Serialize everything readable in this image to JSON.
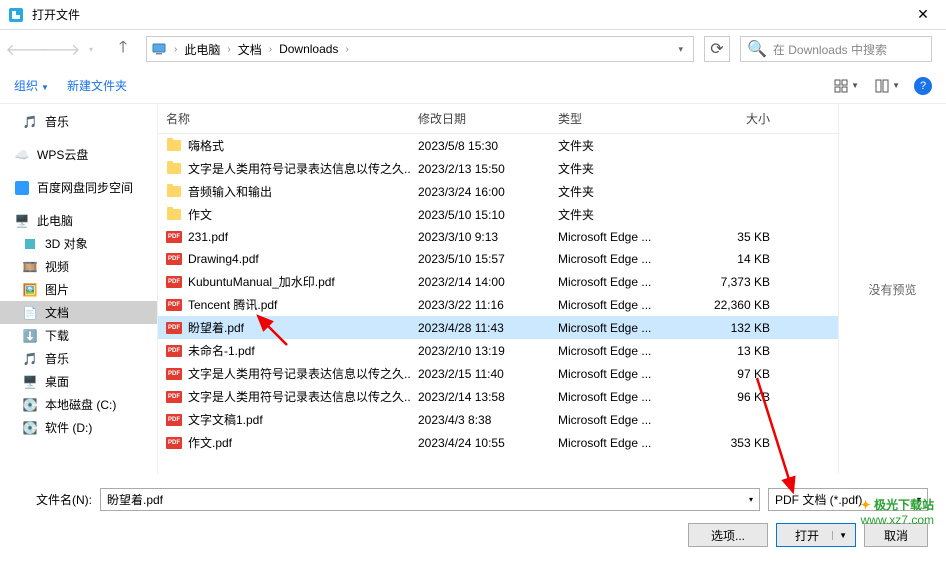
{
  "title": "打开文件",
  "breadcrumb": {
    "pc": "此电脑",
    "docs": "文档",
    "downloads": "Downloads"
  },
  "search_placeholder": "在 Downloads 中搜索",
  "toolbar": {
    "organize": "组织",
    "newfolder": "新建文件夹"
  },
  "sidebar": {
    "music": "音乐",
    "wps": "WPS云盘",
    "baidu": "百度网盘同步空间",
    "thispc": "此电脑",
    "obj3d": "3D 对象",
    "video": "视频",
    "pictures": "图片",
    "documents": "文档",
    "downloads_s": "下载",
    "music2": "音乐",
    "desktop": "桌面",
    "diskc": "本地磁盘 (C:)",
    "diskd": "软件 (D:)"
  },
  "columns": {
    "name": "名称",
    "date": "修改日期",
    "type": "类型",
    "size": "大小"
  },
  "rows": [
    {
      "icon": "folder",
      "name": "嗨格式",
      "date": "2023/5/8 15:30",
      "type": "文件夹",
      "size": ""
    },
    {
      "icon": "folder",
      "name": "文字是人类用符号记录表达信息以传之久...",
      "date": "2023/2/13 15:50",
      "type": "文件夹",
      "size": ""
    },
    {
      "icon": "folder",
      "name": "音频输入和输出",
      "date": "2023/3/24 16:00",
      "type": "文件夹",
      "size": ""
    },
    {
      "icon": "folder",
      "name": "作文",
      "date": "2023/5/10 15:10",
      "type": "文件夹",
      "size": ""
    },
    {
      "icon": "pdf",
      "name": "231.pdf",
      "date": "2023/3/10 9:13",
      "type": "Microsoft Edge ...",
      "size": "35 KB"
    },
    {
      "icon": "pdf",
      "name": "Drawing4.pdf",
      "date": "2023/5/10 15:57",
      "type": "Microsoft Edge ...",
      "size": "14 KB"
    },
    {
      "icon": "pdf",
      "name": "KubuntuManual_加水印.pdf",
      "date": "2023/2/14 14:00",
      "type": "Microsoft Edge ...",
      "size": "7,373 KB"
    },
    {
      "icon": "pdf",
      "name": "Tencent 腾讯.pdf",
      "date": "2023/3/22 11:16",
      "type": "Microsoft Edge ...",
      "size": "22,360 KB"
    },
    {
      "icon": "pdf",
      "name": "盼望着.pdf",
      "date": "2023/4/28 11:43",
      "type": "Microsoft Edge ...",
      "size": "132 KB",
      "selected": true
    },
    {
      "icon": "pdf",
      "name": "未命名-1.pdf",
      "date": "2023/2/10 13:19",
      "type": "Microsoft Edge ...",
      "size": "13 KB"
    },
    {
      "icon": "pdf",
      "name": "文字是人类用符号记录表达信息以传之久...",
      "date": "2023/2/15 11:40",
      "type": "Microsoft Edge ...",
      "size": "97 KB"
    },
    {
      "icon": "pdf",
      "name": "文字是人类用符号记录表达信息以传之久...",
      "date": "2023/2/14 13:58",
      "type": "Microsoft Edge ...",
      "size": "96 KB"
    },
    {
      "icon": "pdf",
      "name": "文字文稿1.pdf",
      "date": "2023/4/3 8:38",
      "type": "Microsoft Edge ...",
      "size": ""
    },
    {
      "icon": "pdf",
      "name": "作文.pdf",
      "date": "2023/4/24 10:55",
      "type": "Microsoft Edge ...",
      "size": "353 KB"
    }
  ],
  "preview_text": "没有预览",
  "filename_label": "文件名(N):",
  "filename_value": "盼望着.pdf",
  "filter": "PDF 文档 (*.pdf)",
  "buttons": {
    "options": "选项...",
    "open": "打开",
    "cancel": "取消"
  },
  "watermark": {
    "line1": "极光下载站",
    "line2": "www.xz7.com"
  }
}
